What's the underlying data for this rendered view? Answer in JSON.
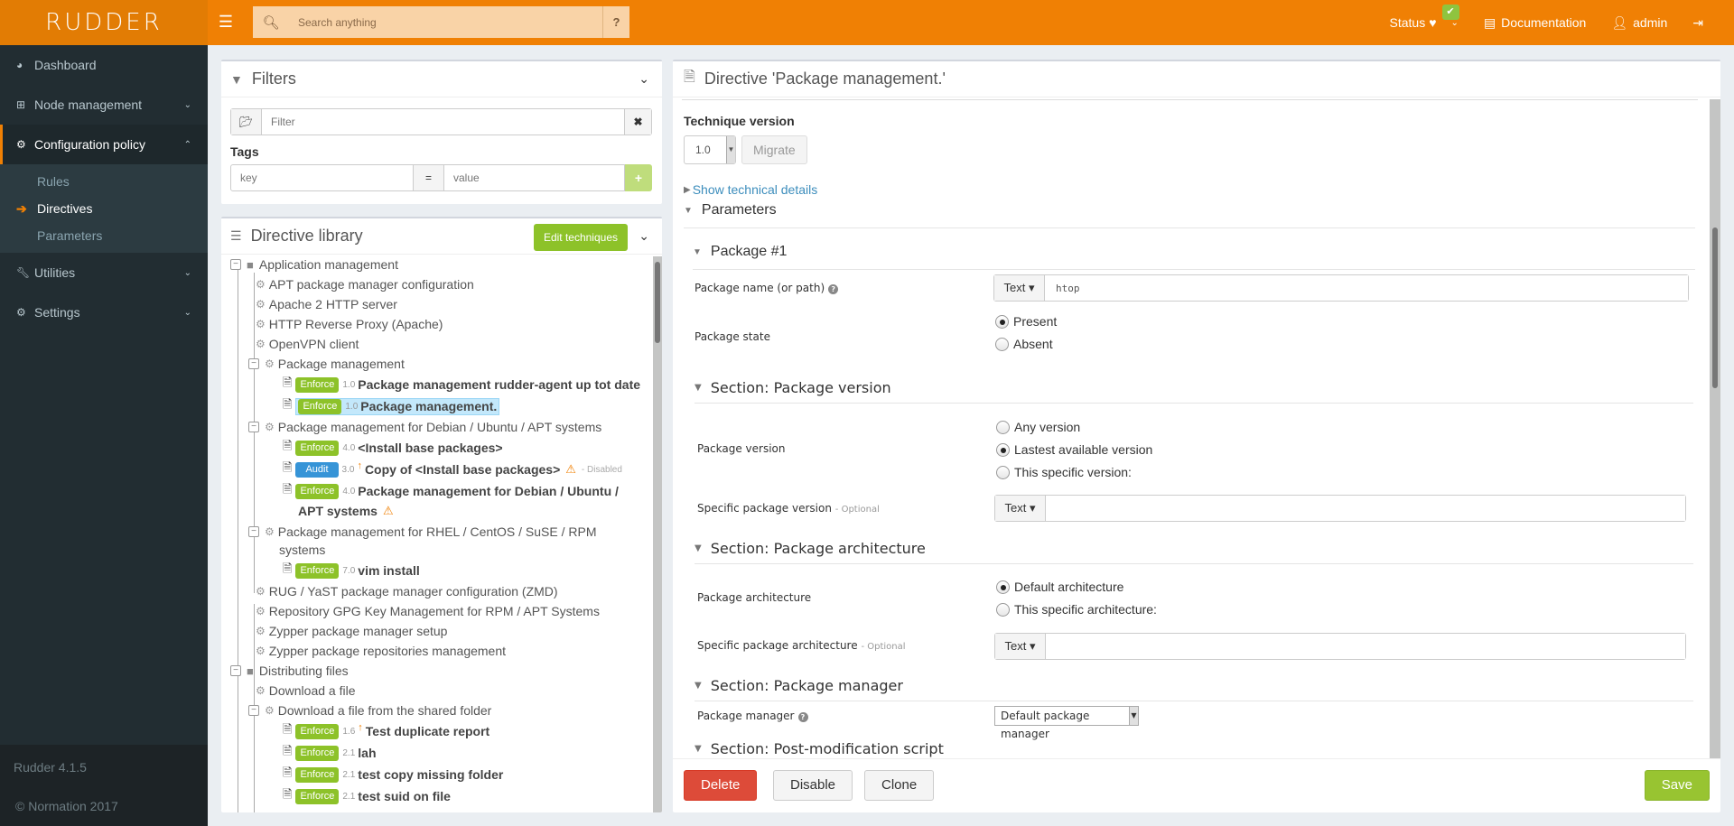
{
  "header": {
    "logo": "RUDDER",
    "search_placeholder": "Search anything",
    "status_label": "Status",
    "documentation_label": "Documentation",
    "user_label": "admin"
  },
  "sidebar": {
    "items": [
      {
        "label": "Dashboard"
      },
      {
        "label": "Node management"
      },
      {
        "label": "Configuration policy"
      },
      {
        "label": "Utilities"
      },
      {
        "label": "Settings"
      }
    ],
    "sub_items": [
      {
        "label": "Rules"
      },
      {
        "label": "Directives"
      },
      {
        "label": "Parameters"
      }
    ],
    "version": "Rudder 4.1.5",
    "copyright": "© Normation 2017"
  },
  "filters": {
    "title": "Filters",
    "filter_placeholder": "Filter",
    "tags_label": "Tags",
    "key_placeholder": "key",
    "equals": "=",
    "value_placeholder": "value",
    "add": "+"
  },
  "library": {
    "title": "Directive library",
    "edit_techniques": "Edit techniques",
    "tree": {
      "cat1": "Application management",
      "t1": "APT package manager configuration",
      "t2": "Apache 2 HTTP server",
      "t3": "HTTP Reverse Proxy (Apache)",
      "t4": "OpenVPN client",
      "t5": "Package management",
      "d5a": {
        "mode": "Enforce",
        "version": "1.0",
        "name": "Package management rudder-agent up tot date"
      },
      "d5b": {
        "mode": "Enforce",
        "version": "1.0",
        "name": "Package management."
      },
      "t6": "Package management for Debian / Ubuntu / APT systems",
      "d6a": {
        "mode": "Enforce",
        "version": "4.0",
        "name": "<Install base packages>"
      },
      "d6b": {
        "mode": "Audit",
        "version": "3.0",
        "name": "Copy of <Install base packages>",
        "status": "- Disabled"
      },
      "d6c": {
        "mode": "Enforce",
        "version": "4.0",
        "name": "Package management for Debian / Ubuntu /",
        "name2": "APT systems"
      },
      "t7": "Package management for RHEL / CentOS / SuSE / RPM",
      "t7b": "systems",
      "d7a": {
        "mode": "Enforce",
        "version": "7.0",
        "name": "vim install"
      },
      "t8": "RUG / YaST package manager configuration (ZMD)",
      "t9": "Repository GPG Key Management for RPM / APT Systems",
      "t10": "Zypper package manager setup",
      "t11": "Zypper package repositories management",
      "cat2": "Distributing files",
      "t12": "Download a file",
      "t13": "Download a file from the shared folder",
      "d13a": {
        "mode": "Enforce",
        "version": "1.6",
        "name": "Test duplicate report"
      },
      "d13b": {
        "mode": "Enforce",
        "version": "2.1",
        "name": "lah"
      },
      "d13c": {
        "mode": "Enforce",
        "version": "2.1",
        "name": "test copy missing folder"
      },
      "d13d": {
        "mode": "Enforce",
        "version": "2.1",
        "name": "test suid on file"
      }
    }
  },
  "directive": {
    "title": "Directive 'Package management.'",
    "technique_version_label": "Technique version",
    "technique_version": "1.0",
    "migrate": "Migrate",
    "show_technical": "Show technical details",
    "parameters": "Parameters",
    "package1": "Package #1",
    "pkg_name_label": "Package name (or path)",
    "type_text": "Text ▾",
    "pkg_name_value": "htop",
    "pkg_state_label": "Package state",
    "state_options": [
      "Present",
      "Absent"
    ],
    "state_selected": "Present",
    "sec_version": "Section: Package version",
    "pkg_version_label": "Package version",
    "version_options": [
      "Any version",
      "Lastest available version",
      "This specific version:"
    ],
    "version_selected": "Lastest available version",
    "specific_version_label": "Specific package version",
    "optional": "- Optional",
    "sec_arch": "Section: Package architecture",
    "pkg_arch_label": "Package architecture",
    "arch_options": [
      "Default architecture",
      "This specific architecture:"
    ],
    "arch_selected": "Default architecture",
    "specific_arch_label": "Specific package architecture",
    "sec_manager": "Section: Package manager",
    "pkg_manager_label": "Package manager",
    "pkg_manager_value": "Default package manager",
    "sec_post": "Section: Post-modification script",
    "delete": "Delete",
    "disable": "Disable",
    "clone": "Clone",
    "save": "Save"
  }
}
